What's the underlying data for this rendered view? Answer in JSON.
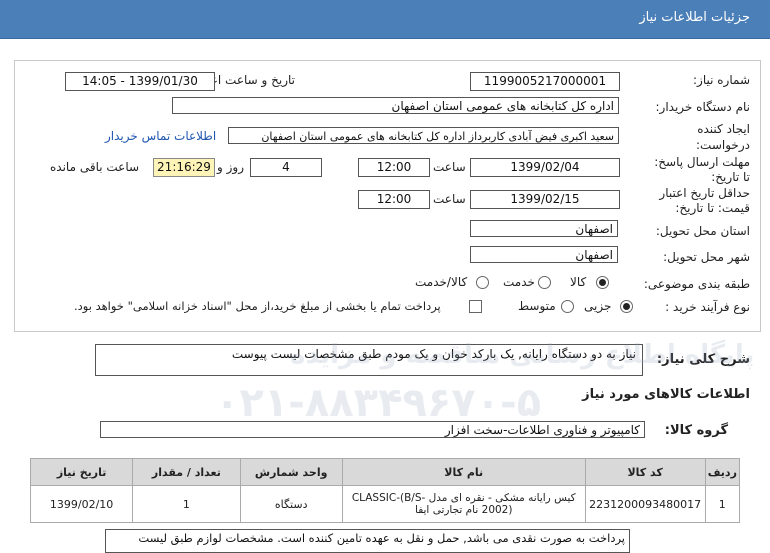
{
  "page": {
    "title": "جزئیات اطلاعات نیاز"
  },
  "form": {
    "need_number_label": "شماره نیاز:",
    "need_number": "1199005217000001",
    "announce_label": "تاریخ و ساعت اعلان عمومی:",
    "announce_value": "1399/01/30 - 14:05",
    "buyer_label": "نام دستگاه خریدار:",
    "buyer_value": "اداره کل کتابخانه های عمومی استان اصفهان",
    "creator_label_1": "ایجاد کننده",
    "creator_label_2": "درخواست:",
    "creator_value": "سعید اکبری فیض آبادی کاربرداز اداره کل کتابخانه های عمومی استان اصفهان",
    "contact_link": "اطلاعات تماس خریدار",
    "deadline_label_1": "مهلت ارسال پاسخ:",
    "deadline_label_2": "تا تاریخ:",
    "deadline_date": "1399/02/04",
    "time_label": "ساعت",
    "deadline_time": "12:00",
    "days_value": "4",
    "days_label": "روز و",
    "remaining_time": "21:16:29",
    "remaining_label": "ساعت باقی مانده",
    "validity_label_1": "حداقل تاریخ اعتبار",
    "validity_label_2": "قیمت: تا تاریخ:",
    "validity_date": "1399/02/15",
    "validity_time": "12:00",
    "province_label": "استان محل تحویل:",
    "province_value": "اصفهان",
    "city_label": "شهر محل تحویل:",
    "city_value": "اصفهان",
    "category_label": "طبقه بندی موضوعی:",
    "category_options": [
      "کالا",
      "خدمت",
      "کالا/خدمت"
    ],
    "process_label": "نوع فرآیند خرید :",
    "process_options": [
      "جزیی",
      "متوسط"
    ],
    "payment_note": "پرداخت تمام یا بخشی از مبلغ خرید،از محل \"اسناد خزانه اسلامی\" خواهد بود."
  },
  "summary": {
    "label": "شرح کلی نیاز:",
    "value": "نیاز به دو دستگاه رایانه, یک بارکد خوان و یک مودم طبق مشخصات لیست پیوست"
  },
  "goods_info_title": "اطلاعات کالاهای مورد نیاز",
  "goods_group": {
    "label": "گروه کالا:",
    "value": "کامپیوتر و فناوری اطلاعات-سخت افزار"
  },
  "table": {
    "headers": [
      "ردیف",
      "کد کالا",
      "نام کالا",
      "واحد شمارش",
      "تعداد / مقدار",
      "تاریخ نیاز"
    ],
    "rows": [
      [
        "1",
        "2231200093480017",
        "کیس رایانه مشکی - نقره ای مدل CLASSIC-(B/S-2002) نام تجارتی ایفا",
        "دستگاه",
        "1",
        "1399/02/10"
      ]
    ]
  },
  "bottom_note": "پرداخت به صورت نقدی می باشد, حمل و نقل به عهده تامین کننده است. مشخصات لوازم طبق لیست",
  "watermark": {
    "line1": "پایگاه اطلاع رسانی مناقصه و مزایده",
    "line2": "۰۲۱-۸۸۳۴۹۶۷۰-۵"
  }
}
